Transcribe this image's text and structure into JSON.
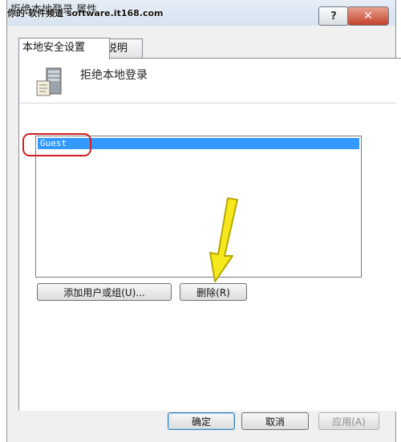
{
  "window": {
    "title": "拒绝本地登录 属性",
    "watermark": "你的·软件频道 software.it168.com",
    "help_glyph": "?",
    "close_glyph": "✕"
  },
  "tabs": [
    {
      "label": "本地安全设置"
    },
    {
      "label": "说明"
    }
  ],
  "policy": {
    "name": "拒绝本地登录",
    "icon": "server-computer-icon"
  },
  "accounts": {
    "items": [
      "Guest"
    ],
    "selected": "Guest"
  },
  "buttons": {
    "add": "添加用户或组(U)...",
    "remove": "删除(R)"
  },
  "footer": {
    "ok": "确定",
    "cancel": "取消",
    "apply": "应用(A)"
  },
  "annotations": {
    "oval_color": "#d11f1f",
    "arrow_color": "#f5e81c",
    "arrow_icon": "down-arrow-icon"
  }
}
